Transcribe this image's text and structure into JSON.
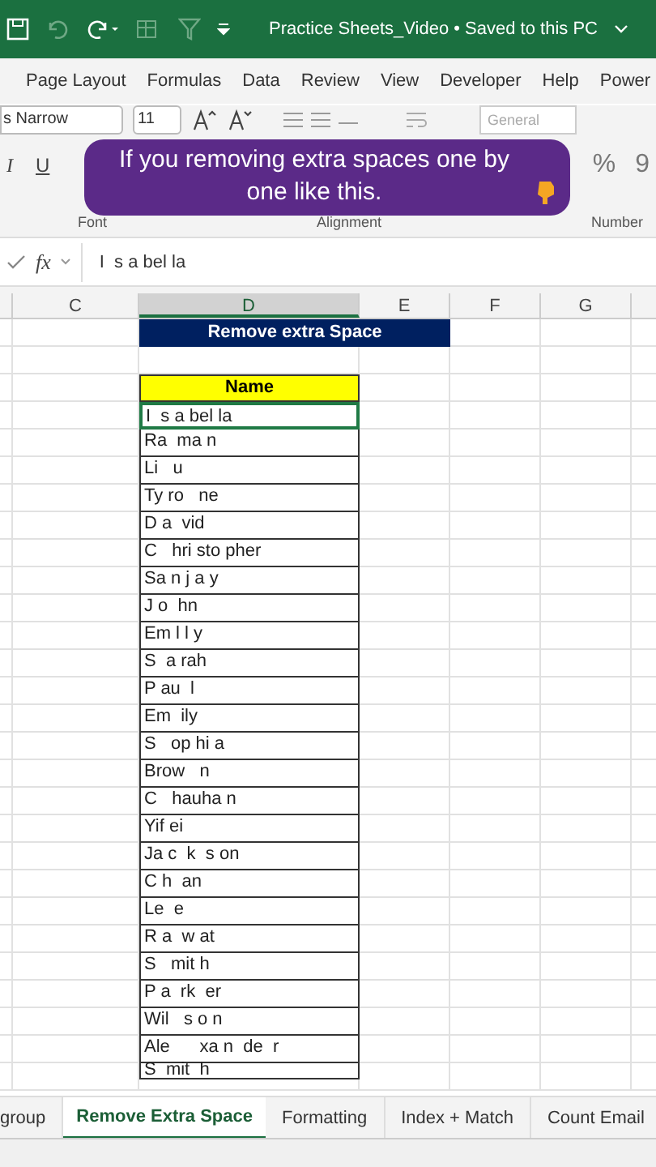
{
  "title_bar": {
    "title": "Practice Sheets_Video • Saved to this PC"
  },
  "ribbon_tabs": [
    "Page Layout",
    "Formulas",
    "Data",
    "Review",
    "View",
    "Developer",
    "Help",
    "Power"
  ],
  "ribbon": {
    "font_name": "s Narrow",
    "font_size": "11",
    "number_format": "General",
    "format_buttons": [
      "I",
      "U"
    ],
    "number_buttons": [
      "%",
      "9"
    ],
    "groups": [
      "Font",
      "Alignment",
      "Number"
    ]
  },
  "caption": {
    "text": "If you removing extra spaces one by one like this."
  },
  "formula_bar": {
    "fx": "fx",
    "value": "I  s a bel la"
  },
  "columns": [
    {
      "label": "C",
      "selected": false
    },
    {
      "label": "D",
      "selected": true
    },
    {
      "label": "E",
      "selected": false
    },
    {
      "label": "F",
      "selected": false
    },
    {
      "label": "G",
      "selected": false
    }
  ],
  "sheet": {
    "title": "Remove extra Space",
    "header": "Name",
    "rows": [
      {
        "name": "I  s a bel la",
        "selected": true
      },
      {
        "name": "Ra  ma n",
        "selected": false
      },
      {
        "name": "Li   u",
        "selected": false
      },
      {
        "name": "Ty ro   ne",
        "selected": false
      },
      {
        "name": "D a  vid",
        "selected": false
      },
      {
        "name": "C   hri sto pher",
        "selected": false
      },
      {
        "name": "Sa n j a y",
        "selected": false
      },
      {
        "name": "J o  hn",
        "selected": false
      },
      {
        "name": "Em l l y",
        "selected": false
      },
      {
        "name": "S  a rah",
        "selected": false
      },
      {
        "name": "P au  l",
        "selected": false
      },
      {
        "name": "Em  ily",
        "selected": false
      },
      {
        "name": "S   op hi a",
        "selected": false
      },
      {
        "name": "Brow   n",
        "selected": false
      },
      {
        "name": "C   hauha n",
        "selected": false
      },
      {
        "name": "Yif ei",
        "selected": false
      },
      {
        "name": "Ja c  k  s on",
        "selected": false
      },
      {
        "name": "C h  an",
        "selected": false
      },
      {
        "name": "Le  e",
        "selected": false
      },
      {
        "name": "R a  w at",
        "selected": false
      },
      {
        "name": "S   mit h",
        "selected": false
      },
      {
        "name": "P a  rk  er",
        "selected": false
      },
      {
        "name": "Wil   s o n",
        "selected": false
      },
      {
        "name": "Ale      xa n  de  r",
        "selected": false
      },
      {
        "name": "S  mit  h",
        "selected": false
      }
    ]
  },
  "sheet_tabs": [
    {
      "label": "group",
      "selected": false
    },
    {
      "label": "Remove Extra Space",
      "selected": true
    },
    {
      "label": "Formatting",
      "selected": false
    },
    {
      "label": "Index + Match",
      "selected": false
    },
    {
      "label": "Count Email",
      "selected": false
    }
  ]
}
